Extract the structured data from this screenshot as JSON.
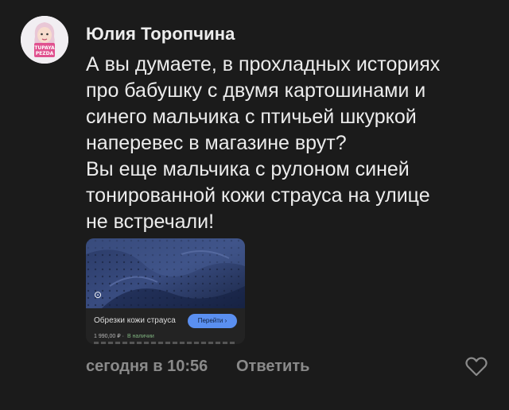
{
  "comment": {
    "author": "Юлия Торопчина",
    "avatar_label_top": "TUPAYA",
    "avatar_label_bottom": "PEZDA",
    "text_lines": [
      "А вы думаете, в прохладных историях",
      "про бабушку с двумя картошинами и",
      "синего мальчика с  птичьей шкуркой",
      "наперевес в магазине врут?",
      "Вы еще мальчика с рулоном синей",
      "тонированной кожи страуса на улице",
      "не встречали!"
    ],
    "attachment": {
      "title": "Обрезки кожи страуса",
      "button_label": "Перейти ›",
      "price": "1 990,00 ₽ ·",
      "availability": "В наличии",
      "lens_icon": "lens-icon"
    },
    "time": "сегодня в 10:56",
    "reply_label": "Ответить",
    "like_icon": "heart-icon"
  },
  "colors": {
    "background": "#1b1b1b",
    "text": "#ececec",
    "muted": "#8a8a8a",
    "button": "#5a8ff0",
    "avatar_bg": "#f1eef2",
    "avatar_label": "#e0508f"
  }
}
